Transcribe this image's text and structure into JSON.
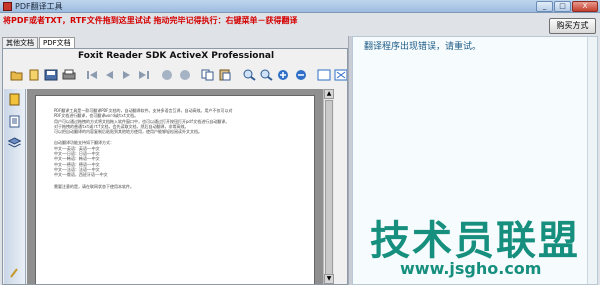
{
  "window": {
    "title": "PDF翻译工具",
    "controls": [
      "_",
      "□",
      "X"
    ]
  },
  "notice": "将PDF或者TXT，RTF文件拖到这里试试    拖动完毕记得执行：右键菜单－获得翻译",
  "buy_button": "购买方式",
  "tabs": [
    "其他文档",
    "PDF文档"
  ],
  "pdf_viewer": {
    "title": "Foxit Reader SDK ActiveX Professional",
    "toolbar": [
      "open-icon",
      "bookmark-icon",
      "save-icon",
      "print-icon",
      "first-page-icon",
      "prev-page-icon",
      "next-page-icon",
      "last-page-icon",
      "back-icon",
      "forward-icon",
      "copy-icon",
      "paste-icon",
      "zoom-in-icon",
      "zoom-out-icon",
      "plus-icon",
      "minus-icon",
      "actual-size-icon",
      "fit-page-icon"
    ],
    "page_lines": [
      "PDF翻译工具是一款可翻译PDF文档的，自动翻译软件。支持多语言互译，自动高效。用户不仅可以对",
      "PDF文档进行翻译，也可翻译word或txt文档。",
      "用户可以通过拖拽的方式将文档拖入软件窗口中，也可以通过打开按钮打开pdf文档进行自动翻译。",
      "对于拖拽的普通txt或rtf文档，会先读取文档，然后自动翻译，非常高效。",
      "可以把自动翻译的内容复制后粘贴到其他地方使用，使用户能够轻松阅读外文文档。"
    ],
    "page_block2": [
      "自动翻译功能支持如下翻译方式：",
      "中文——英语：英语——中文",
      "中文——日语：日语——中文",
      "中文——韩语：韩语——中文",
      "中文——德语：德语——中文",
      "中文——法语：法语——中文",
      "中文——俄语，西班牙语——中文"
    ],
    "page_block3": "需要注意的是，请在联网状态下使用本软件。"
  },
  "result": {
    "text": "翻译程序出现错误，请重试。"
  },
  "watermark": {
    "name": "技术员联盟",
    "url": "www.jsgho.com"
  },
  "colors": {
    "notice": "#d40000",
    "result_text": "#1c5b86",
    "watermark": "#0b8a78"
  }
}
